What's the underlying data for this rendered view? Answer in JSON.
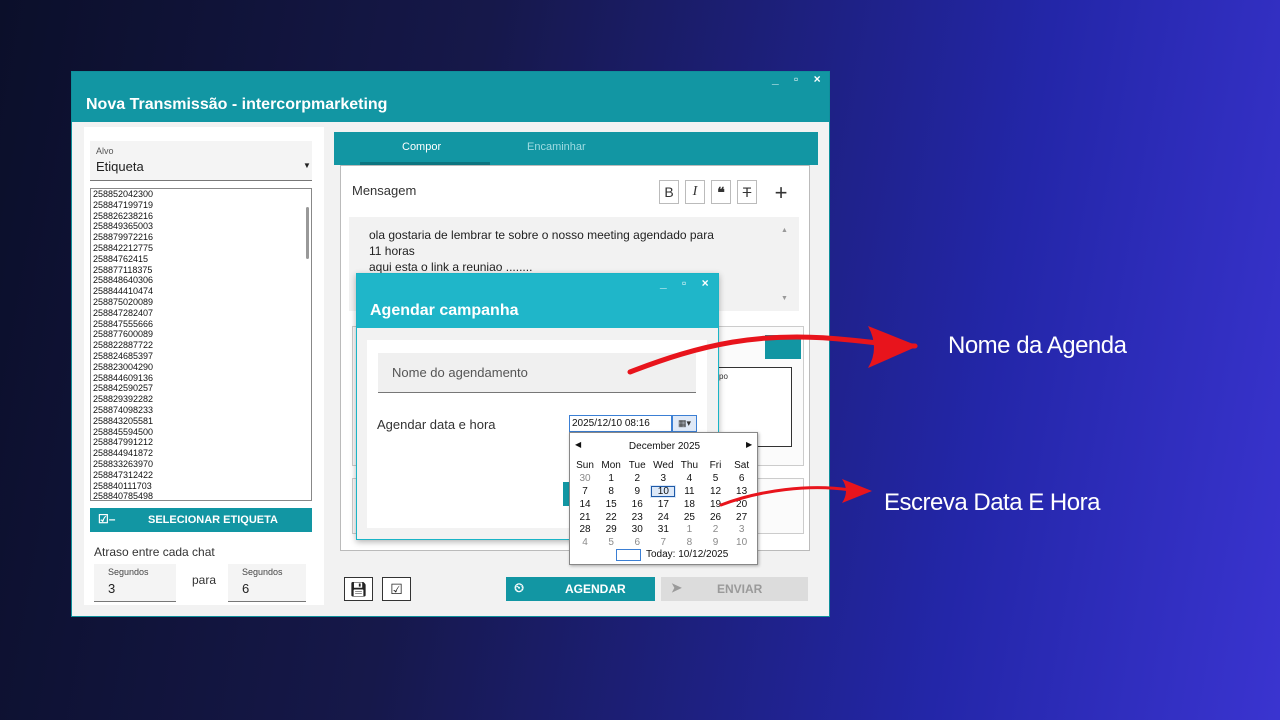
{
  "window": {
    "title": "Nova Transmissão - intercorpmarketing",
    "controls": "_ ▫ ×"
  },
  "left": {
    "alvo_label": "Alvo",
    "alvo_value": "Etiqueta",
    "contacts": [
      "258852042300",
      "258847199719",
      "258826238216",
      "258849365003",
      "258879972216",
      "258842212775",
      "25884762415",
      "258877118375",
      "258848640306",
      "258844410474",
      "258875020089",
      "258847282407",
      "258847555666",
      "258877600089",
      "258822887722",
      "258824685397",
      "258823004290",
      "258844609136",
      "258842590257",
      "258829392282",
      "258874098233",
      "258843205581",
      "258845594500",
      "258847991212",
      "258844941872",
      "258833263970",
      "258847312422",
      "258840111703",
      "258840785498"
    ],
    "select_button": "SELECIONAR ETIQUETA",
    "delay_label": "Atraso entre cada chat",
    "from_label": "Segundos",
    "from_value": "3",
    "para": "para",
    "to_label": "Segundos",
    "to_value": "6"
  },
  "tabs": {
    "compor": "Compor",
    "encaminhar": "Encaminhar"
  },
  "compose": {
    "mensagem_label": "Mensagem",
    "message_lines": [
      "ola gostaria de lembrar te sobre o nosso meeting agendado para",
      "11 horas",
      "aqui esta o link a reuniao ........"
    ],
    "table_header": "po"
  },
  "actions": {
    "agendar": "AGENDAR",
    "enviar": "ENVIAR"
  },
  "dialog": {
    "title": "Agendar campanha",
    "controls": "_ ▫ ×",
    "nome_placeholder": "Nome do agendamento",
    "datetime_label": "Agendar data e hora",
    "datetime_value": "2025/12/10 08:16"
  },
  "calendar": {
    "month": "December 2025",
    "weekdays": [
      "Sun",
      "Mon",
      "Tue",
      "Wed",
      "Thu",
      "Fri",
      "Sat"
    ],
    "weeks": [
      [
        "30",
        "1",
        "2",
        "3",
        "4",
        "5",
        "6"
      ],
      [
        "7",
        "8",
        "9",
        "10",
        "11",
        "12",
        "13"
      ],
      [
        "14",
        "15",
        "16",
        "17",
        "18",
        "19",
        "20"
      ],
      [
        "21",
        "22",
        "23",
        "24",
        "25",
        "26",
        "27"
      ],
      [
        "28",
        "29",
        "30",
        "31",
        "1",
        "2",
        "3"
      ],
      [
        "4",
        "5",
        "6",
        "7",
        "8",
        "9",
        "10"
      ]
    ],
    "selected": "10",
    "today_label": "Today: 10/12/2025"
  },
  "annotations": {
    "nome": "Nome da Agenda",
    "data": "Escreva Data E Hora",
    "arrow_color": "#e8141c"
  },
  "colors": {
    "teal": "#1296a3",
    "dialog_teal": "#1fb6c9",
    "background": "#2326a8"
  }
}
